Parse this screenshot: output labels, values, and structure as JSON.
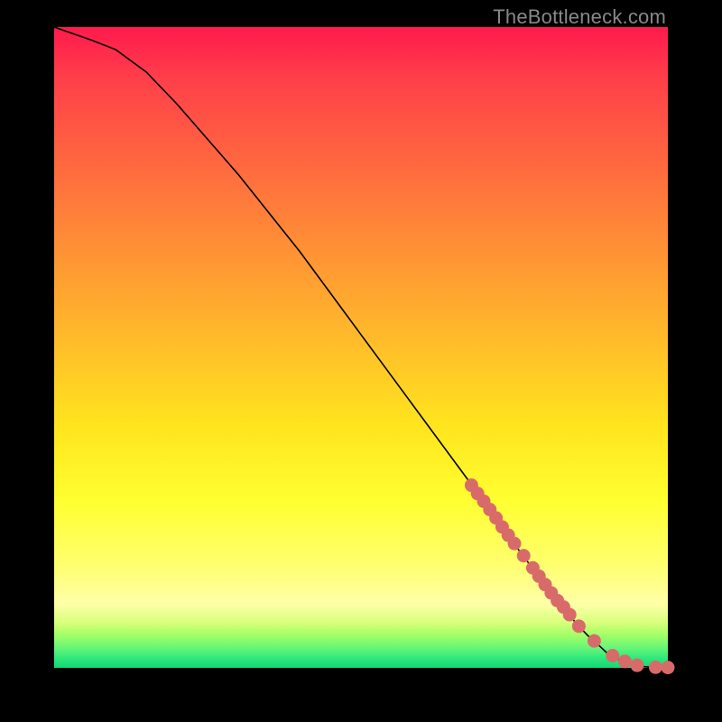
{
  "watermark": "TheBottleneck.com",
  "colors": {
    "background": "#000000",
    "curve": "#000000",
    "marker": "#d96a6a"
  },
  "chart_data": {
    "type": "line",
    "title": "",
    "xlabel": "",
    "ylabel": "",
    "xlim": [
      0,
      100
    ],
    "ylim": [
      0,
      100
    ],
    "grid": false,
    "legend": false,
    "series": [
      {
        "name": "curve",
        "x": [
          0,
          3,
          6,
          10,
          15,
          20,
          25,
          30,
          35,
          40,
          45,
          50,
          55,
          60,
          65,
          70,
          73,
          76,
          80,
          83,
          85,
          87,
          89,
          90,
          92,
          94,
          96,
          98,
          100
        ],
        "y": [
          100,
          99,
          98,
          96.5,
          93,
          88,
          82.5,
          77,
          71,
          65,
          58.5,
          52,
          45.5,
          39,
          32.5,
          26,
          22,
          18,
          13,
          9.5,
          7,
          5,
          3.3,
          2.4,
          1.3,
          0.6,
          0.2,
          0.05,
          0
        ]
      }
    ],
    "markers": {
      "name": "highlighted-points",
      "style": "circle",
      "radius": 1.1,
      "x": [
        68,
        69,
        70,
        71,
        72,
        73,
        74,
        75,
        76.5,
        78,
        79,
        80,
        81,
        82,
        83,
        84,
        85.5,
        88,
        91,
        93,
        95,
        98,
        100
      ],
      "y": [
        28.5,
        27.2,
        26,
        24.7,
        23.4,
        22,
        20.7,
        19.4,
        17.5,
        15.6,
        14.3,
        13,
        11.7,
        10.5,
        9.5,
        8.3,
        6.5,
        4.2,
        1.9,
        1.0,
        0.4,
        0.1,
        0.05
      ]
    }
  }
}
